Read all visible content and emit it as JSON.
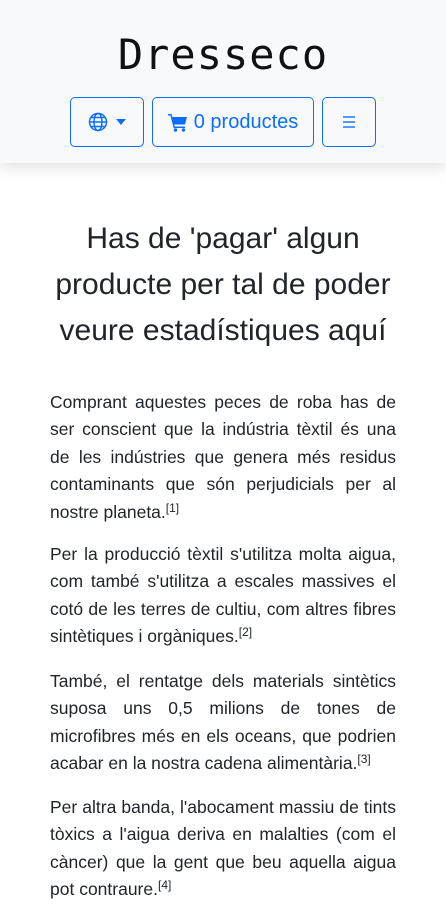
{
  "header": {
    "brand": "Dresseco",
    "language_icon": "globe-icon",
    "cart_icon": "cart-icon",
    "cart_label": "0 productes",
    "menu_icon": "hamburger-icon",
    "accent_color": "#0d6efd"
  },
  "main": {
    "heading": "Has de 'pagar' algun producte per tal de poder veure estadístiques aquí",
    "paragraphs": [
      {
        "text": "Comprant aquestes peces de roba has de ser conscient que la indústria tèxtil és una de les indústries que genera més residus contaminants que són perjudicials per al nostre planeta.",
        "ref": "[1]"
      },
      {
        "text": "Per la producció tèxtil s'utilitza molta aigua, com també s'utilitza a escales massives el cotó de les terres de cultiu, com altres fibres sintètiques i orgàniques.",
        "ref": "[2]"
      },
      {
        "text": "També, el rentatge dels materials sintètics suposa uns 0,5 milions de tones de microfibres més en els oceans, que podrien acabar en la nostra cadena alimentària.",
        "ref": "[3]"
      },
      {
        "text": "Per altra banda, l'abocament massiu de tints tòxics a l'aigua deriva en malalties (com el càncer) que la gent que beu aquella aigua pot contraure.",
        "ref": "[4]"
      }
    ]
  }
}
